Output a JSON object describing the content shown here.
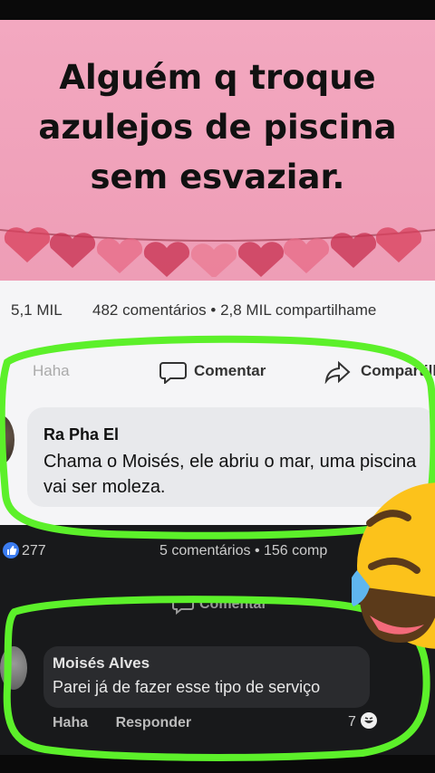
{
  "post": {
    "title_lines": [
      "Alguém q troque",
      "azulejos de piscina",
      "sem esvaziar."
    ],
    "like_count": "5,1 MIL",
    "comments_shares": "482 comentários • 2,8 MIL compartilhame",
    "actions": {
      "haha": "Haha",
      "comment": "Comentar",
      "share": "Compartilhar"
    }
  },
  "comment1": {
    "author": "Ra Pha El",
    "text": "Chama o Moisés,  ele abriu o mar, uma piscina vai ser moleza."
  },
  "second_post": {
    "like_count": "277",
    "comments_shares": "5 comentários • 156 comp",
    "actions": {
      "comment": "Comentar"
    }
  },
  "comment2": {
    "author": "Moisés Alves",
    "text": "Parei já de fazer esse tipo de serviço",
    "haha_label": "Haha",
    "reply_label": "Responder",
    "reaction_count": "7"
  },
  "colors": {
    "highlight_green": "#5cf02a",
    "pink_bg": "#f3a8c0",
    "heart": "#e0405e"
  },
  "icons": [
    "heart-icon",
    "like-icon",
    "comment-icon",
    "share-icon",
    "laughing-emoji-icon",
    "haha-reaction-icon"
  ]
}
